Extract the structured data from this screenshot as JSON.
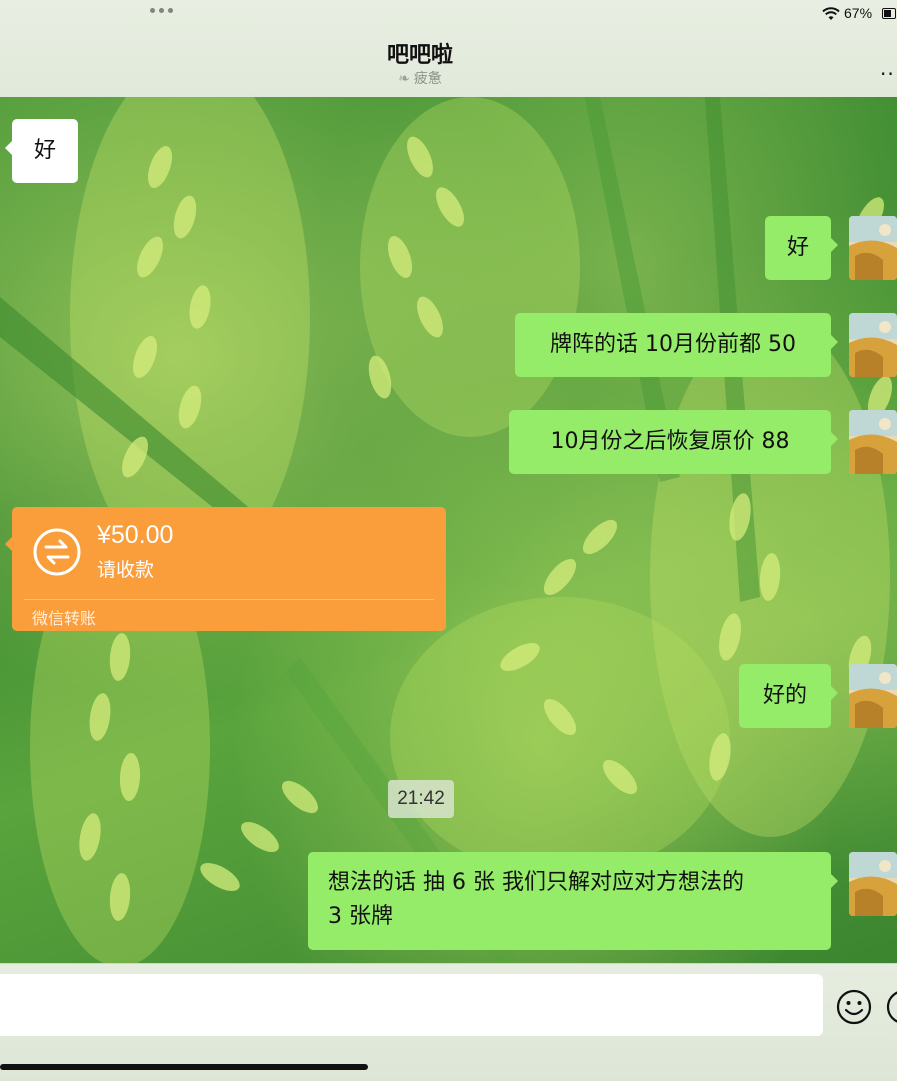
{
  "status_bar": {
    "battery_text": "67%",
    "battery_level": 0.67,
    "wifi_icon": "wifi-icon"
  },
  "nav": {
    "title": "吧吧啦",
    "status_icon": "leaf-status-icon",
    "status_text": "疲惫",
    "more_icon": "more-dots-icon",
    "more_label": ".."
  },
  "messages": [
    {
      "side": "in",
      "text": "好"
    },
    {
      "side": "out",
      "text": "好"
    },
    {
      "side": "out",
      "text": "牌阵的话 10月份前都 50"
    },
    {
      "side": "out",
      "text": "10月份之后恢复原价 88"
    },
    {
      "side": "out",
      "text": "好的"
    },
    {
      "side": "out",
      "line1": "想法的话 抽 6 张  我们只解对应对方想法的",
      "line2": "3 张牌"
    }
  ],
  "transfer": {
    "amount": "¥50.00",
    "status": "请收款",
    "footer": "微信转账",
    "icon": "transfer-exchange-icon",
    "color": "#fa9d3b"
  },
  "timestamp": "21:42",
  "input": {
    "value": "",
    "emoji_icon": "smiley-icon",
    "plus_icon": "plus-circle-icon"
  },
  "colors": {
    "outgoing_bubble": "#95ec69",
    "incoming_bubble": "#ffffff",
    "chat_background": "#4f9a3a"
  }
}
